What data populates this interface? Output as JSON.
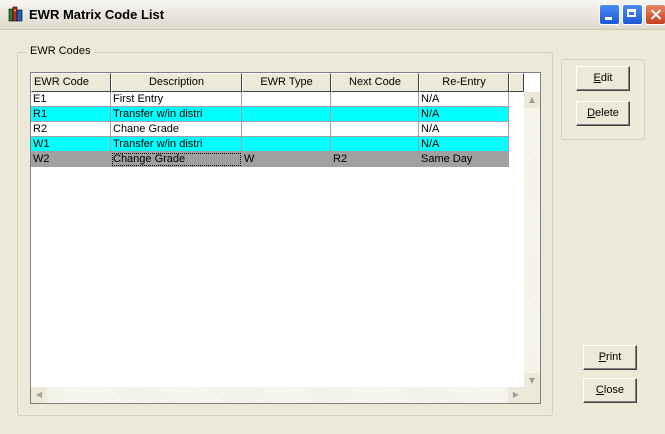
{
  "window": {
    "title": "EWR Matrix Code List",
    "icon": "books-icon"
  },
  "group": {
    "label": "EWR Codes"
  },
  "grid": {
    "columns": [
      "EWR Code",
      "Description",
      "EWR Type",
      "Next Code",
      "Re-Entry"
    ],
    "rows": [
      {
        "code": "E1",
        "description": "First Entry",
        "type": "",
        "next": "",
        "reentry": "N/A",
        "style": "white"
      },
      {
        "code": "R1",
        "description": "Transfer w/in distri",
        "type": "",
        "next": "",
        "reentry": "N/A",
        "style": "cyan"
      },
      {
        "code": "R2",
        "description": "Chane Grade",
        "type": "",
        "next": "",
        "reentry": "N/A",
        "style": "white"
      },
      {
        "code": "W1",
        "description": "Transfer w/in distri",
        "type": "",
        "next": "",
        "reentry": "N/A",
        "style": "cyan"
      },
      {
        "code": "W2",
        "description": "Change Grade",
        "type": "W",
        "next": "R2",
        "reentry": "Same Day",
        "style": "grey"
      }
    ]
  },
  "buttons": {
    "edit": {
      "mnemonic": "E",
      "rest": "dit"
    },
    "delete": {
      "mnemonic": "D",
      "rest": "elete"
    },
    "print": {
      "mnemonic": "P",
      "rest": "rint"
    },
    "close": {
      "mnemonic": "C",
      "rest": "lose"
    }
  },
  "colors": {
    "highlight_row": "#00ffff",
    "selected_row": "#a0a0a0",
    "window_bg": "#ece9d8"
  }
}
